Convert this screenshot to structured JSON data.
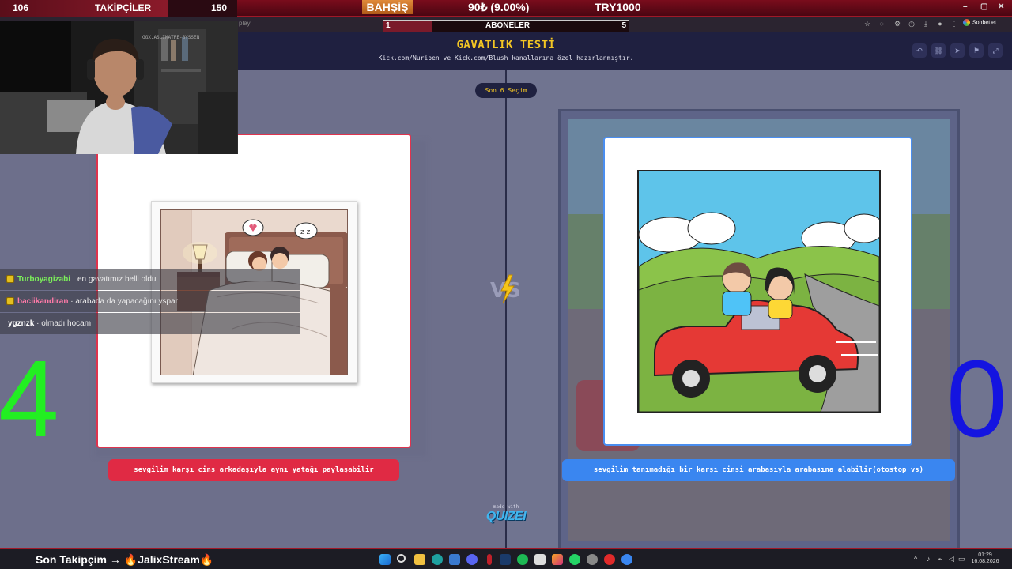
{
  "overlay": {
    "follower_current": "106",
    "follower_label": "TAKİPÇİLER",
    "follower_goal": "150",
    "follower_progress": 0.71,
    "bet_label": "BAHŞİŞ",
    "bet_value": "90₺ (9.00%)",
    "bet_goal": "TRY1000",
    "subs_label": "ABONELER",
    "subs_current": "1",
    "subs_goal": "5",
    "subs_progress": 0.2
  },
  "browser": {
    "url_fragment": "play",
    "chat_button": "Sohbet et"
  },
  "site": {
    "title": "GAVATLIK TESTİ",
    "subtitle": "Kick.com/Nuriben ve Kick.com/Blush kanallarına özel hazırlanmıştır.",
    "pill": "Son 6 Seçim",
    "made_with": "made with",
    "brand": "QUIZEI",
    "vs": "VS"
  },
  "options": {
    "left_caption": "sevgilim karşı cins arkadaşıyla aynı yatağı paylaşabilir",
    "right_caption": "sevgilim tanımadığı bir karşı cinsi arabasıyla arabasına alabilir(otostop vs)"
  },
  "scores": {
    "left": "4",
    "right": "0",
    "left_color": "#22ee22",
    "right_color": "#1414e0"
  },
  "chat": [
    {
      "user": "Turboyagizabi",
      "message": "en gavatımız belli oldu",
      "color": "#7cf05a",
      "badge": true
    },
    {
      "user": "baciikandiran",
      "message": "arabada da yapacağını yspar",
      "color": "#ff7aa8",
      "badge": true
    },
    {
      "user": "ygznzk",
      "message": "olmadı hocam",
      "color": "#ffffff",
      "badge": false
    }
  ],
  "webcam": {
    "watermark": "GGX.ASLIMATRE-BYSSEN"
  },
  "taskbar": {
    "last_follow": "Son Takipçim → 🔥JalixStream🔥",
    "time": "01:29",
    "date": "16.08.2026"
  },
  "colors": {
    "accent_red": "#e0344e",
    "accent_blue": "#3a86f0",
    "title_yellow": "#f3c623"
  }
}
